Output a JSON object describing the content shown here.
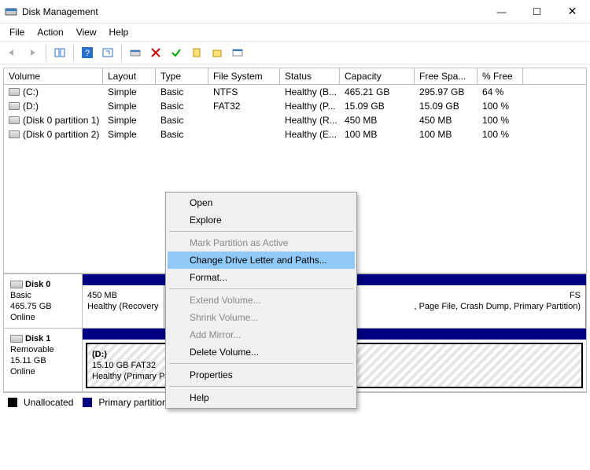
{
  "window": {
    "title": "Disk Management",
    "min": "—",
    "max": "☐",
    "close": "✕"
  },
  "menu": {
    "file": "File",
    "action": "Action",
    "view": "View",
    "help": "Help"
  },
  "columns": {
    "volume": "Volume",
    "layout": "Layout",
    "type": "Type",
    "fs": "File System",
    "status": "Status",
    "capacity": "Capacity",
    "free": "Free Spa...",
    "pct": "% Free"
  },
  "volumes": [
    {
      "name": "(C:)",
      "layout": "Simple",
      "type": "Basic",
      "fs": "NTFS",
      "status": "Healthy (B...",
      "capacity": "465.21 GB",
      "free": "295.97 GB",
      "pct": "64 %"
    },
    {
      "name": "(D:)",
      "layout": "Simple",
      "type": "Basic",
      "fs": "FAT32",
      "status": "Healthy (P...",
      "capacity": "15.09 GB",
      "free": "15.09 GB",
      "pct": "100 %"
    },
    {
      "name": "(Disk 0 partition 1)",
      "layout": "Simple",
      "type": "Basic",
      "fs": "",
      "status": "Healthy (R...",
      "capacity": "450 MB",
      "free": "450 MB",
      "pct": "100 %"
    },
    {
      "name": "(Disk 0 partition 2)",
      "layout": "Simple",
      "type": "Basic",
      "fs": "",
      "status": "Healthy (E...",
      "capacity": "100 MB",
      "free": "100 MB",
      "pct": "100 %"
    }
  ],
  "disk0": {
    "label": "Disk 0",
    "type": "Basic",
    "size": "465.75 GB",
    "state": "Online",
    "p1_l1": "450 MB",
    "p1_l2": "Healthy (Recovery",
    "p2_l1": "",
    "p2_l2": "",
    "p3_l1": "FS",
    "p3_l2": ", Page File, Crash Dump, Primary Partition)"
  },
  "disk1": {
    "label": "Disk 1",
    "type": "Removable",
    "size": "15.11 GB",
    "state": "Online",
    "p_l1": "(D:)",
    "p_l2": "15.10 GB FAT32",
    "p_l3": "Healthy (Primary Partition)"
  },
  "legend": {
    "unalloc": "Unallocated",
    "primary": "Primary partition"
  },
  "ctx": {
    "open": "Open",
    "explore": "Explore",
    "mark": "Mark Partition as Active",
    "change": "Change Drive Letter and Paths...",
    "format": "Format...",
    "extend": "Extend Volume...",
    "shrink": "Shrink Volume...",
    "mirror": "Add Mirror...",
    "delete": "Delete Volume...",
    "props": "Properties",
    "help": "Help"
  }
}
